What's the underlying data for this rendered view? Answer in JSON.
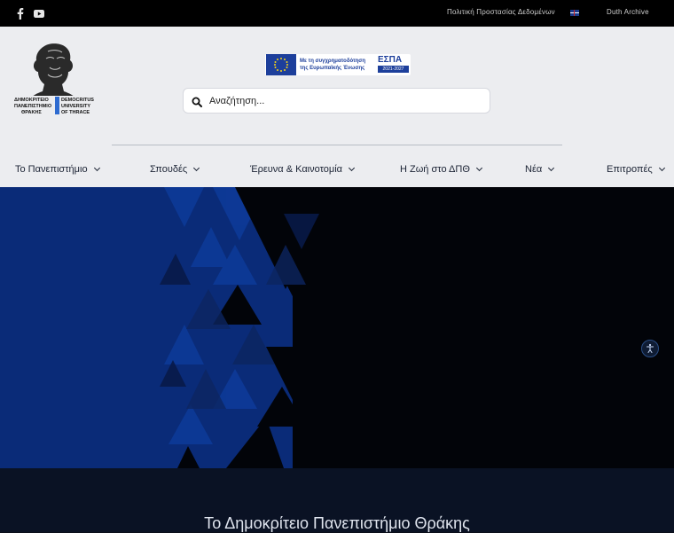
{
  "topbar": {
    "social": [
      {
        "icon": "facebook-icon"
      },
      {
        "icon": "youtube-icon"
      }
    ],
    "privacy_link": "Πολιτική Προστασίας Δεδομένων",
    "language_icon": "english-flag-icon",
    "archive_link": "Duth Archive"
  },
  "header": {
    "logo_lines": {
      "gr": [
        "ΔΗΜΟΚΡΙΤΕΙΟ",
        "ΠΑΝΕΠΙΣΤΗΜΙΟ",
        "ΘΡΑΚΗΣ"
      ],
      "en": [
        "DEMOCRITUS",
        "UNIVERSITY",
        "OF THRACE"
      ]
    },
    "espa_banner": {
      "line1": "Με τη συγχρηματοδότηση",
      "line2": "της Ευρωπαϊκής Ένωσης",
      "brand": "ΕΣΠΑ",
      "years": "2021-2027"
    },
    "search": {
      "placeholder": "Αναζήτηση..."
    }
  },
  "nav": {
    "items": [
      {
        "label": "Το Πανεπιστήμιο"
      },
      {
        "label": "Σπουδές"
      },
      {
        "label": "Έρευνα & Καινοτομία"
      },
      {
        "label": "Η Ζωή στο ΔΠΘ"
      },
      {
        "label": "Νέα"
      },
      {
        "label": "Επιτροπές"
      }
    ]
  },
  "colors": {
    "hero_blue": "#0a2b78",
    "hero_dark": "#020409",
    "nav_text": "#1a2233",
    "espa_blue": "#1d3f9b"
  },
  "accessibility": {
    "icon": "accessibility-icon"
  },
  "section": {
    "title": "Το Δημοκρίτειο Πανεπιστήμιο Θράκης"
  }
}
